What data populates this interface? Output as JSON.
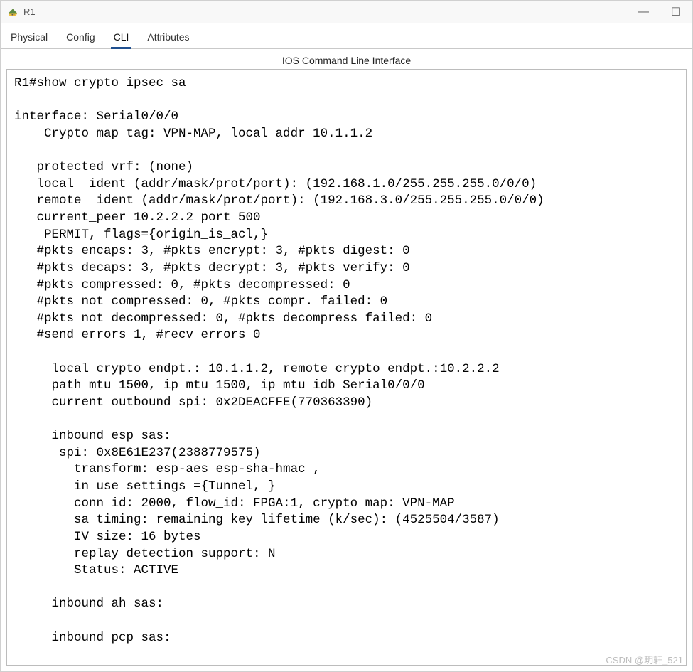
{
  "window": {
    "title": "R1",
    "controls": {
      "minimize": "—",
      "maximize": "☐",
      "close": "✕"
    }
  },
  "tabs": [
    {
      "label": "Physical",
      "active": false
    },
    {
      "label": "Config",
      "active": false
    },
    {
      "label": "CLI",
      "active": true
    },
    {
      "label": "Attributes",
      "active": false
    }
  ],
  "panel": {
    "title": "IOS Command Line Interface"
  },
  "cli_output": "R1#show crypto ipsec sa\n\ninterface: Serial0/0/0\n    Crypto map tag: VPN-MAP, local addr 10.1.1.2\n\n   protected vrf: (none)\n   local  ident (addr/mask/prot/port): (192.168.1.0/255.255.255.0/0/0)\n   remote  ident (addr/mask/prot/port): (192.168.3.0/255.255.255.0/0/0)\n   current_peer 10.2.2.2 port 500\n    PERMIT, flags={origin_is_acl,}\n   #pkts encaps: 3, #pkts encrypt: 3, #pkts digest: 0\n   #pkts decaps: 3, #pkts decrypt: 3, #pkts verify: 0\n   #pkts compressed: 0, #pkts decompressed: 0\n   #pkts not compressed: 0, #pkts compr. failed: 0\n   #pkts not decompressed: 0, #pkts decompress failed: 0\n   #send errors 1, #recv errors 0\n\n     local crypto endpt.: 10.1.1.2, remote crypto endpt.:10.2.2.2\n     path mtu 1500, ip mtu 1500, ip mtu idb Serial0/0/0\n     current outbound spi: 0x2DEACFFE(770363390)\n\n     inbound esp sas:\n      spi: 0x8E61E237(2388779575)\n        transform: esp-aes esp-sha-hmac ,\n        in use settings ={Tunnel, }\n        conn id: 2000, flow_id: FPGA:1, crypto map: VPN-MAP\n        sa timing: remaining key lifetime (k/sec): (4525504/3587)\n        IV size: 16 bytes\n        replay detection support: N\n        Status: ACTIVE\n\n     inbound ah sas:\n\n     inbound pcp sas:",
  "watermark": "CSDN @玥轩_521"
}
